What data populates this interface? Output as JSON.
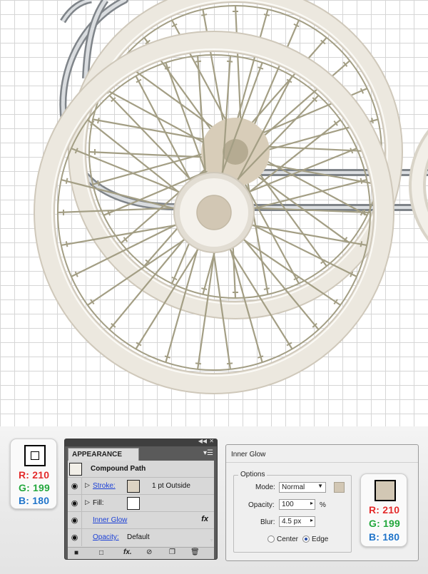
{
  "colors": {
    "tire": "#ece8df",
    "spokes": "#a39e84",
    "hub": "#d2c7b4",
    "axle": "#8f9499",
    "red": "#e22a2a",
    "green": "#22a63c",
    "blue": "#1f73c8"
  },
  "swatch_left": {
    "r": "R: 210",
    "g": "G: 199",
    "b": "B: 180"
  },
  "swatch_right": {
    "r": "R: 210",
    "g": "G: 199",
    "b": "B: 180"
  },
  "appearance": {
    "tab": "APPEARANCE",
    "title": "Compound Path",
    "stroke_label": "Stroke:",
    "stroke_value": "1 pt  Outside",
    "fill_label": "Fill:",
    "effect_label": "Inner Glow",
    "fx": "fx",
    "opacity_label": "Opacity:",
    "opacity_value": "Default"
  },
  "inner_glow": {
    "title": "Inner Glow",
    "options_label": "Options",
    "mode_label": "Mode:",
    "mode_value": "Normal",
    "opacity_label": "Opacity:",
    "opacity_value": "100",
    "opacity_unit": "%",
    "blur_label": "Blur:",
    "blur_value": "4.5 px",
    "center_label": "Center",
    "edge_label": "Edge",
    "glow_color": "#d2c7b4"
  },
  "icons": {
    "eye": "eye-icon",
    "triangle": "disclosure-triangle-icon",
    "panel_menu": "panel-menu-icon",
    "fx": "fx-icon",
    "new_item": "new-item-icon",
    "delete": "trash-icon"
  }
}
